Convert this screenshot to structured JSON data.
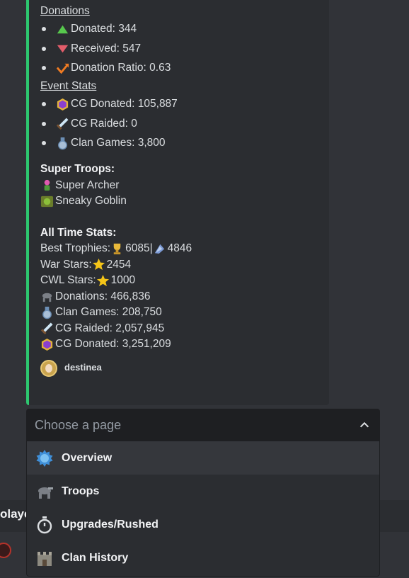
{
  "embed": {
    "donations_header": "Donations",
    "donations": [
      {
        "icon": "triangle-up-icon",
        "text": "Donated: 344"
      },
      {
        "icon": "triangle-down-icon",
        "text": "Received: 547"
      },
      {
        "icon": "ratio-chart-icon",
        "text": "Donation Ratio: 0.63"
      }
    ],
    "event_header": "Event Stats",
    "events": [
      {
        "icon": "hexagon-gem-icon",
        "text": "CG Donated: 105,887"
      },
      {
        "icon": "sword-icon",
        "text": "CG Raided: 0"
      },
      {
        "icon": "medal-icon",
        "text": "Clan Games: 3,800"
      }
    ],
    "super_troops_title": "Super Troops:",
    "super_troops": [
      {
        "icon": "super-archer-icon",
        "text": "Super Archer"
      },
      {
        "icon": "sneaky-goblin-icon",
        "text": "Sneaky Goblin"
      }
    ],
    "all_time_title": "All Time Stats:",
    "best_trophies_label": "Best Trophies: ",
    "best_trophies_home": "6085",
    "best_trophies_sep": " | ",
    "best_trophies_builder": "4846",
    "war_stars": "War Stars: ",
    "war_stars_value": "2454",
    "cwl_stars": "CWL Stars: ",
    "cwl_stars_value": " 1000",
    "all_time_donations": "Donations: 466,836",
    "all_time_clan_games": " Clan Games: 208,750",
    "all_time_cg_raided": "CG Raided: 2,057,945",
    "all_time_cg_donated": "CG Donated: 3,251,209",
    "footer_name": "destinea"
  },
  "select": {
    "placeholder": "Choose a page",
    "options": [
      {
        "label": "Overview",
        "icon": "overview-gear-icon",
        "selected": true
      },
      {
        "label": "Troops",
        "icon": "troops-icon",
        "selected": false
      },
      {
        "label": "Upgrades/Rushed",
        "icon": "stopwatch-icon",
        "selected": false
      },
      {
        "label": "Clan History",
        "icon": "clan-castle-icon",
        "selected": false
      }
    ]
  },
  "background": {
    "partial_text": "olaye"
  },
  "colors": {
    "embed_border": "#2dc770",
    "embed_bg": "#2b2d31",
    "page_bg": "#313338",
    "select_bg": "#1e1f22",
    "option_selected_bg": "#35373c"
  }
}
